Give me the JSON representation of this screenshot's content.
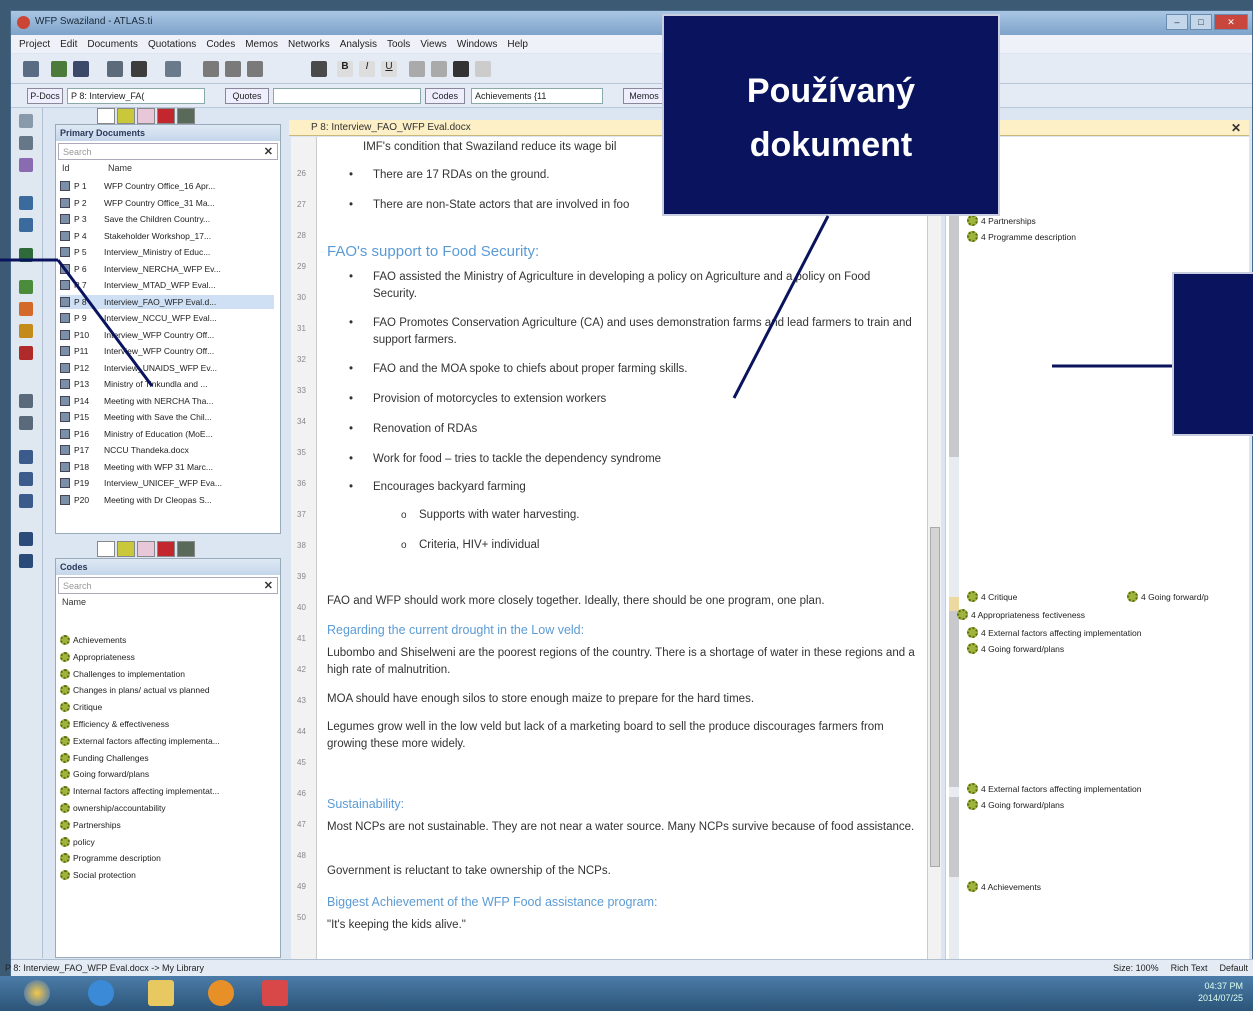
{
  "window": {
    "title": "WFP Swaziland - ATLAS.ti"
  },
  "menu": [
    "Project",
    "Edit",
    "Documents",
    "Quotations",
    "Codes",
    "Memos",
    "Networks",
    "Analysis",
    "Tools",
    "Views",
    "Windows",
    "Help"
  ],
  "toolbar2": {
    "pdocs_label": "P-Docs",
    "pdoc_select": "P 8: Interview_FA(",
    "quotes_label": "Quotes",
    "codes_label": "Codes",
    "code_select": "Achievements {11",
    "memos_label": "Memos"
  },
  "primary_docs": {
    "title": "Primary Documents",
    "search_placeholder": "Search",
    "col_id": "Id",
    "col_name": "Name",
    "rows": [
      {
        "id": "P 1",
        "name": "WFP Country Office_16 Apr..."
      },
      {
        "id": "P 2",
        "name": "WFP Country Office_31 Ma..."
      },
      {
        "id": "P 3",
        "name": "Save the Children Country..."
      },
      {
        "id": "P 4",
        "name": "Stakeholder Workshop_17..."
      },
      {
        "id": "P 5",
        "name": "Interview_Ministry of Educ..."
      },
      {
        "id": "P 6",
        "name": "Interview_NERCHA_WFP Ev..."
      },
      {
        "id": "P 7",
        "name": "Interview_MTAD_WFP Eval..."
      },
      {
        "id": "P 8",
        "name": "Interview_FAO_WFP Eval.d..."
      },
      {
        "id": "P 9",
        "name": "Interview_NCCU_WFP Eval..."
      },
      {
        "id": "P10",
        "name": "Interview_WFP Country Off..."
      },
      {
        "id": "P11",
        "name": "Interview_WFP Country Off..."
      },
      {
        "id": "P12",
        "name": "Interview_UNAIDS_WFP Ev..."
      },
      {
        "id": "P13",
        "name": "Ministry of Tinkundla and ..."
      },
      {
        "id": "P14",
        "name": "Meeting with NERCHA Tha..."
      },
      {
        "id": "P15",
        "name": "Meeting with Save the Chil..."
      },
      {
        "id": "P16",
        "name": "Ministry of Education (MoE..."
      },
      {
        "id": "P17",
        "name": "NCCU Thandeka.docx"
      },
      {
        "id": "P18",
        "name": "Meeting with WFP 31 Marc..."
      },
      {
        "id": "P19",
        "name": "Interview_UNICEF_WFP Eva..."
      },
      {
        "id": "P20",
        "name": "Meeting with Dr Cleopas S..."
      }
    ]
  },
  "codes": {
    "title": "Codes",
    "search_placeholder": "Search",
    "col_name": "Name",
    "rows": [
      "Achievements",
      "Appropriateness",
      "Challenges to implementation",
      "Changes in plans/ actual vs planned",
      "Critique",
      "Efficiency & effectiveness",
      "External factors affecting implementa...",
      "Funding Challenges",
      "Going forward/plans",
      "Internal factors affecting implementat...",
      "ownership/accountability",
      "Partnerships",
      "policy",
      "Programme description",
      "Social protection"
    ]
  },
  "document": {
    "tab_title": "P 8: Interview_FAO_WFP Eval.docx",
    "line0": "IMF's condition that Swaziland reduce its wage bil",
    "b1": "There are 17 RDAs on the ground.",
    "b2": "There are non-State actors that are involved in foo",
    "h1": "FAO's support to Food Security:",
    "b3": "FAO assisted the Ministry of Agriculture in developing a policy on Agriculture and a policy on Food Security.",
    "b4": "FAO Promotes Conservation Agriculture (CA) and uses demonstration farms and lead farmers to train and support farmers.",
    "b5": "FAO and the MOA spoke to chiefs about proper farming skills.",
    "b6": "Provision of motorcycles to extension workers",
    "b7": "Renovation of RDAs",
    "b8": "Work for food – tries to tackle the dependency syndrome",
    "b9": "Encourages backyard farming",
    "s1": "Supports with water harvesting.",
    "s2": "Criteria, HIV+ individual",
    "p1": "FAO and WFP should work more closely together.  Ideally, there should be one program, one plan.",
    "h2": "Regarding the current drought in the Low veld:",
    "p2": "Lubombo and Shiselweni are the poorest regions of the country.  There is a shortage of water in these regions and a high rate of malnutrition.",
    "p3": "MOA should have enough silos to store enough maize to prepare for the hard times.",
    "p4": "Legumes grow well in the low veld but lack of a marketing board to sell the produce discourages farmers from growing these more widely.",
    "h3": "Sustainability:",
    "p5": "Most NCPs are not sustainable.  They are not near a water source.  Many NCPs survive because of food assistance.",
    "p6": "Government is reluctant to take ownership of the NCPs.",
    "h4": "Biggest Achievement of the WFP Food assistance program:",
    "p7": "\"It's keeping the kids alive.\"",
    "line_numbers": [
      "26",
      "27",
      "28",
      "29",
      "30",
      "31",
      "32",
      "33",
      "34",
      "35",
      "36",
      "37",
      "38",
      "39",
      "40",
      "41",
      "42",
      "43",
      "44",
      "45",
      "46",
      "47",
      "48",
      "49",
      "50"
    ]
  },
  "margin": {
    "m1": "4 Partnerships",
    "m2": "4 Programme description",
    "m3": "4 Critique",
    "m4": "4 Going forward/p",
    "m5": "4 Appropriateness",
    "m5b": "fectiveness",
    "m6": "4 External factors affecting implementation",
    "m7": "4 Going forward/plans",
    "m8": "4 External factors affecting implementation",
    "m9": "4 Going forward/plans",
    "m10": "4 Achievements"
  },
  "status": {
    "left": "P 8: Interview_FAO_WFP Eval.docx -> My Library",
    "size": "Size: 100%",
    "format": "Rich Text",
    "mode": "Default"
  },
  "clock": {
    "time": "04:37 PM",
    "date": "2014/07/25"
  },
  "overlay": {
    "label_line1": "Používaný",
    "label_line2": "dokument"
  },
  "colors": {
    "accent": "#0a145e",
    "heading": "#5b9bd5",
    "doctab": "#fdf0c6"
  }
}
